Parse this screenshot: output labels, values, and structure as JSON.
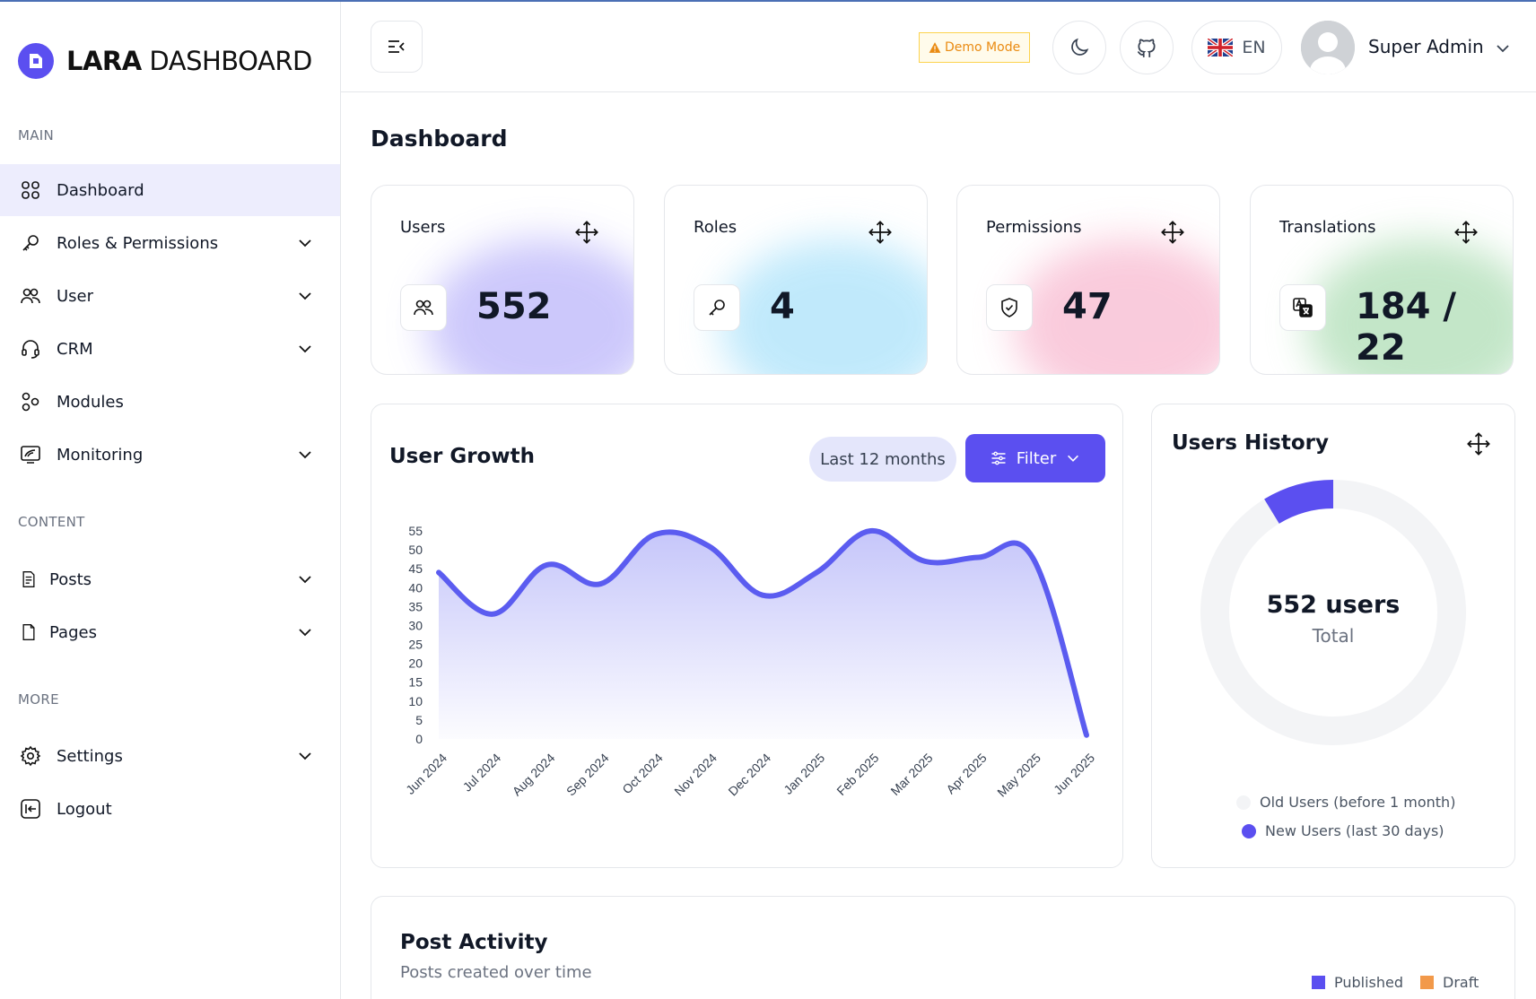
{
  "brand": {
    "bold": "LARA",
    "light": "DASHBOARD",
    "color": "#5b4ff0"
  },
  "sidebar": {
    "sections": {
      "main": "MAIN",
      "content": "CONTENT",
      "more": "MORE"
    },
    "items": [
      {
        "label": "Dashboard",
        "icon": "grid-icon",
        "active": true
      },
      {
        "label": "Roles & Permissions",
        "icon": "key-icon"
      },
      {
        "label": "User",
        "icon": "users-icon"
      },
      {
        "label": "CRM",
        "icon": "headset-icon"
      },
      {
        "label": "Modules",
        "icon": "modules-icon"
      },
      {
        "label": "Monitoring",
        "icon": "monitor-icon"
      },
      {
        "label": "Posts",
        "icon": "post-icon"
      },
      {
        "label": "Pages",
        "icon": "page-icon"
      },
      {
        "label": "Settings",
        "icon": "gear-icon"
      },
      {
        "label": "Logout",
        "icon": "logout-icon"
      }
    ]
  },
  "header": {
    "demo_badge": "Demo Mode",
    "language": "EN",
    "user_name": "Super Admin"
  },
  "page": {
    "title": "Dashboard"
  },
  "stats": [
    {
      "title": "Users",
      "value": "552",
      "icon": "users-icon",
      "glow": "#c7c2fb"
    },
    {
      "title": "Roles",
      "value": "4",
      "icon": "key-icon",
      "glow": "#bfe9fb"
    },
    {
      "title": "Permissions",
      "value": "47",
      "icon": "shield-icon",
      "glow": "#fbc7d9"
    },
    {
      "title": "Translations",
      "value": "184 / 22",
      "icon": "translate-icon",
      "glow": "#bfe5c4"
    }
  ],
  "growth": {
    "title": "User Growth",
    "period": "Last 12 months",
    "filter_label": "Filter"
  },
  "history": {
    "title": "Users History",
    "center_value": "552 users",
    "center_label": "Total",
    "legend_old": "Old Users (before 1 month)",
    "legend_new": "New Users (last 30 days)",
    "old_color": "#f3f4f6",
    "new_color": "#5b4ff0"
  },
  "post_activity": {
    "title": "Post Activity",
    "subtitle": "Posts created over time",
    "legend_published": "Published",
    "legend_draft": "Draft",
    "published_color": "#5b4ff0",
    "draft_color": "#f2994a"
  },
  "chart_data": [
    {
      "type": "area",
      "title": "User Growth",
      "categories": [
        "Jun 2024",
        "Jul 2024",
        "Aug 2024",
        "Sep 2024",
        "Oct 2024",
        "Nov 2024",
        "Dec 2024",
        "Jan 2025",
        "Feb 2025",
        "Mar 2025",
        "Apr 2025",
        "May 2025",
        "Jun 2025"
      ],
      "values": [
        44,
        33,
        46,
        41,
        54,
        51,
        38,
        44,
        55,
        47,
        48,
        48,
        1
      ],
      "yticks": [
        0,
        5,
        10,
        15,
        20,
        25,
        30,
        35,
        40,
        45,
        50,
        55
      ],
      "ylim": [
        0,
        55
      ],
      "color": "#5b5cf0"
    },
    {
      "type": "pie",
      "title": "Users History",
      "labels": [
        "Old Users (before 1 month)",
        "New Users (last 30 days)"
      ],
      "values": [
        504,
        48
      ]
    }
  ]
}
